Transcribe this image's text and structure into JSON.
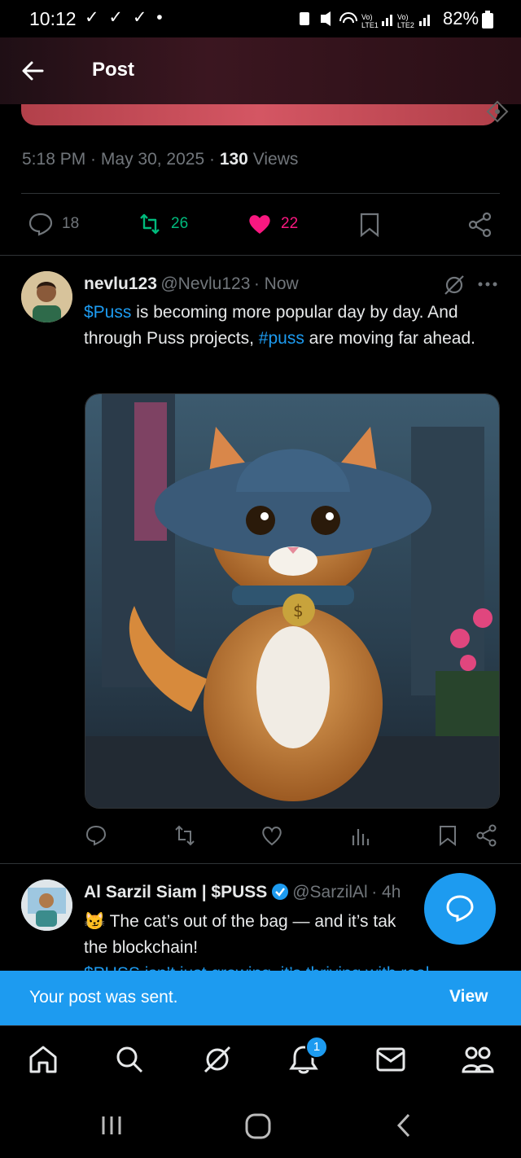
{
  "status_bar": {
    "time": "10:12",
    "checks": "✓ ✓ ✓ •",
    "battery": "82%"
  },
  "header": {
    "title": "Post"
  },
  "post_meta": {
    "time": "5:18 PM",
    "date": "May 30, 2025",
    "views_count": "130",
    "views_label": "Views"
  },
  "post_stats": {
    "replies": "18",
    "reposts": "26",
    "likes": "22"
  },
  "reply1": {
    "name": "nevlu123",
    "handle": "@Nevlu123",
    "time": "Now",
    "text_part1": "$Puss",
    "text_part2": " is becoming more popular day by day. And through Puss projects, ",
    "text_part3": "#puss",
    "text_part4": " are moving far ahead."
  },
  "reply2": {
    "name": "Al Sarzil Siam | $PUSS",
    "handle": "@SarzilAl",
    "time": "4h",
    "line1": "😼 The cat’s out of the bag — and it’s tak",
    "line2": "the blockchain!",
    "line3": "$PUSS isn’t just growing, it’s thriving with real"
  },
  "snackbar": {
    "message": "Your post was sent.",
    "action": "View"
  },
  "nav": {
    "notification_count": "1"
  },
  "colors": {
    "accent": "#1d9bf0",
    "repost_green": "#00ba7c",
    "like_pink": "#f91880",
    "muted": "#71767b"
  }
}
